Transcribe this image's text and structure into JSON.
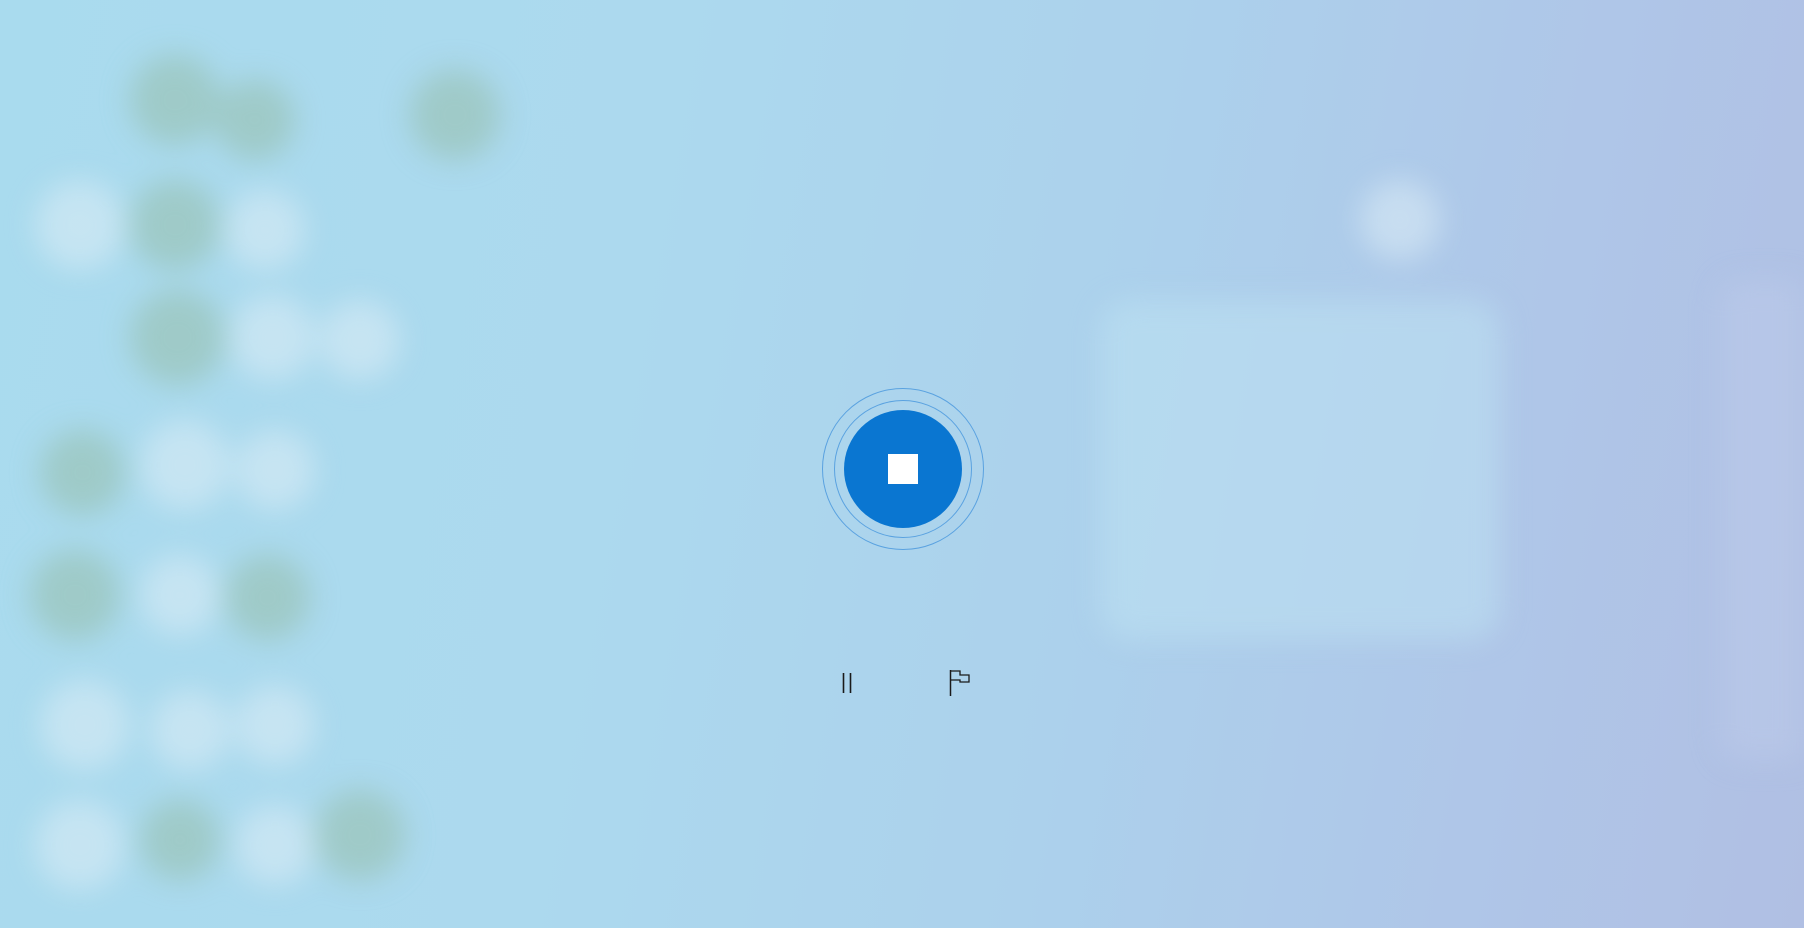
{
  "recorder": {
    "stop_icon": "stop-icon",
    "pause_icon": "pause-icon",
    "flag_icon": "flag-icon"
  },
  "colors": {
    "accent": "#0a76d1",
    "ring": "#5aa2e0",
    "icon_stroke": "#1a1a1a",
    "background_start": "#a9dbee",
    "background_end": "#b0bfe3"
  }
}
